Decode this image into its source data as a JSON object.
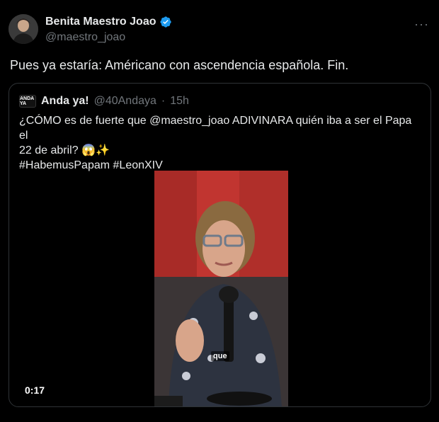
{
  "author": {
    "name": "Benita Maestro Joao",
    "handle": "@maestro_joao",
    "verified_icon": "verified-badge-icon",
    "more_label": "···"
  },
  "tweet": {
    "text": "Pues ya estaría: Américano con ascendencia española. Fin."
  },
  "quoted": {
    "name": "Anda ya!",
    "handle": "@40Andaya",
    "separator": "·",
    "time": "15h",
    "logo_text": "ANDA YA",
    "line1": "¿CÓMO es de fuerte que @maestro_joao ADIVINARA quién iba a ser el Papa el",
    "line2": "22 de abril? 😱✨",
    "line3": "#HabemusPapam #LeonXIV",
    "video": {
      "duration": "0:17",
      "caption": "que"
    }
  },
  "colors": {
    "background": "#000000",
    "text": "#e7e9ea",
    "secondary": "#71767b",
    "verified": "#1d9bf0",
    "border": "#2f3336"
  }
}
